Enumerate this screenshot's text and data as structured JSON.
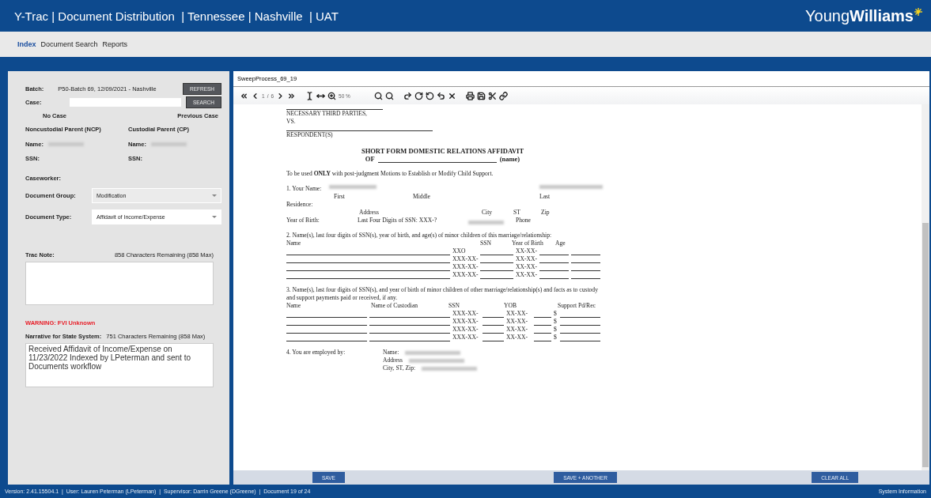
{
  "header": {
    "title": "Y-Trac | Document Distribution  | Tennessee | Nashville  | UAT",
    "logo_light": "Young",
    "logo_bold": "Williams"
  },
  "nav": [
    {
      "label": "Index",
      "selected": true
    },
    {
      "label": "Document Search",
      "selected": false
    },
    {
      "label": "Reports",
      "selected": false
    }
  ],
  "form": {
    "batch_label": "Batch:",
    "batch_value": "P50-Batch 69, 12/09/2021 - Nashville",
    "refresh": "REFRESH",
    "case_label": "Case:",
    "search": "SEARCH",
    "no_case": "No Case",
    "previous_case": "Previous Case",
    "ncp": "Noncustodial Parent (NCP)",
    "cp": "Custodial Parent (CP)",
    "ncp_name": "Name:",
    "cp_name": "Name:",
    "ncp_ssn": "SSN:",
    "cp_ssn": "SSN:",
    "caseworker": "Caseworker:",
    "group_label": "Document Group:",
    "group_value": "Modification",
    "type_label": "Document Type:",
    "type_value": "Affidavit of Income/Expense",
    "trac_label": "Trac Note:",
    "trac_remaining": "858 Characters Remaining (858 Max)",
    "warning": "WARNING: FVI Unknown",
    "narrative_label": "Narrative for State System:",
    "narrative_remaining": "751 Characters Remaining (858 Max)",
    "narrative_value": "Received Affidavit of Income/Expense on 11/23/2022 Indexed by LPeterman and sent to Documents workflow"
  },
  "viewer": {
    "title": "SweepProcess_69_19",
    "page_current": "1",
    "page_sep": "/",
    "page_total": "6",
    "zoom": "50 %"
  },
  "document": {
    "header_lines": [
      "NECESSARY THIRD PARTIES,",
      "VS.",
      "RESPONDENT(S)"
    ],
    "title": "SHORT FORM DOMESTIC RELATIONS AFFIDAVIT",
    "title_of": "OF",
    "title_name": "(name)",
    "instruction": "To be used **ONLY** with post-judgment Motions to Establish or Modify Child Support.",
    "s1_label": "1. Your Name:",
    "name_parts": [
      "First",
      "Middle",
      "Last"
    ],
    "residence": "Residence:",
    "address_parts": [
      "Address",
      "City",
      "ST",
      "Zip"
    ],
    "yob": "Year of Birth:",
    "ssn": "Last Four Digits of SSN: XXX-?",
    "phone": "Phone",
    "s2_text": "2. Name(s), last four digits of SSN(s), year of birth, and age(s) of minor children of this marriage/relationship:",
    "s2_columns": [
      "Name",
      "SSN",
      "Year of Birth",
      "Age"
    ],
    "s2_rows": [
      [
        "XXO",
        "XX-XX-"
      ],
      [
        "XXX-XX-",
        "XX-XX-"
      ],
      [
        "XXX-XX-",
        "XX-XX-"
      ],
      [
        "XXX-XX-",
        "XX-XX-"
      ]
    ],
    "s3_text": "3. Name(s), last four digits of SSN(s), and year of birth of minor children of other marriage/relationship(s) and facts as to custody and support payments paid or received, if any.",
    "s3_columns": [
      "Name",
      "Name of Custodian",
      "SSN",
      "YOB",
      "Support Pd/Rec"
    ],
    "s3_rows": [
      [
        "XXX-XX-",
        "XX-XX-",
        "$"
      ],
      [
        "XXX-XX-",
        "XX-XX-",
        "$"
      ],
      [
        "XXX-XX-",
        "XX-XX-",
        "$"
      ],
      [
        "XXX-XX-",
        "XX-XX-",
        "$"
      ]
    ],
    "s4_label": "4. You are employed by:",
    "s4_fields": [
      "Name:",
      "Address",
      "City, ST, Zip:"
    ]
  },
  "buttons": {
    "save": "SAVE",
    "save_another": "SAVE + ANOTHER",
    "clear": "CLEAR ALL"
  },
  "status": {
    "segments": [
      "Version: 2.41.15504.1",
      "User: Lauren Peterman (LPeterman)",
      "Supervisor: Darrin Greene (DGreene)",
      "Document 19 of 24"
    ],
    "separator": "|",
    "system": "System Information"
  }
}
